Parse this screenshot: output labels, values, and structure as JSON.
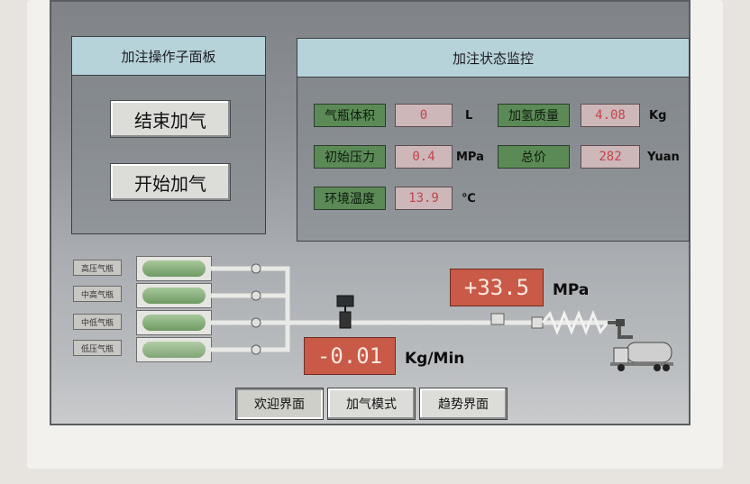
{
  "control_panel": {
    "title": "加注操作子面板",
    "stop_button": "结束加气",
    "start_button": "开始加气"
  },
  "status_panel": {
    "title": "加注状态监控",
    "cylinder_volume": {
      "label": "气瓶体积",
      "value": "0",
      "unit": "L"
    },
    "hydrogen_mass": {
      "label": "加氢质量",
      "value": "4.08",
      "unit": "Kg"
    },
    "initial_pressure": {
      "label": "初始压力",
      "value": "0.4",
      "unit": "MPa"
    },
    "total_price": {
      "label": "总价",
      "value": "282",
      "unit": "Yuan"
    },
    "ambient_temp": {
      "label": "环境温度",
      "value": "13.9",
      "unit": "℃"
    }
  },
  "gas_storage": {
    "labels": [
      "高压气瓶",
      "中高气瓶",
      "中低气瓶",
      "低压气瓶"
    ]
  },
  "readouts": {
    "pressure": {
      "value": "+33.5",
      "unit": "MPa"
    },
    "flow": {
      "value": "-0.01",
      "unit": "Kg/Min"
    }
  },
  "tabs": [
    "欢迎界面",
    "加气模式",
    "趋势界面"
  ],
  "colors": {
    "header": "#b7d3da",
    "label_green": "#5b8a56",
    "value_text": "#c2454d",
    "readout_red": "#c85a47"
  }
}
